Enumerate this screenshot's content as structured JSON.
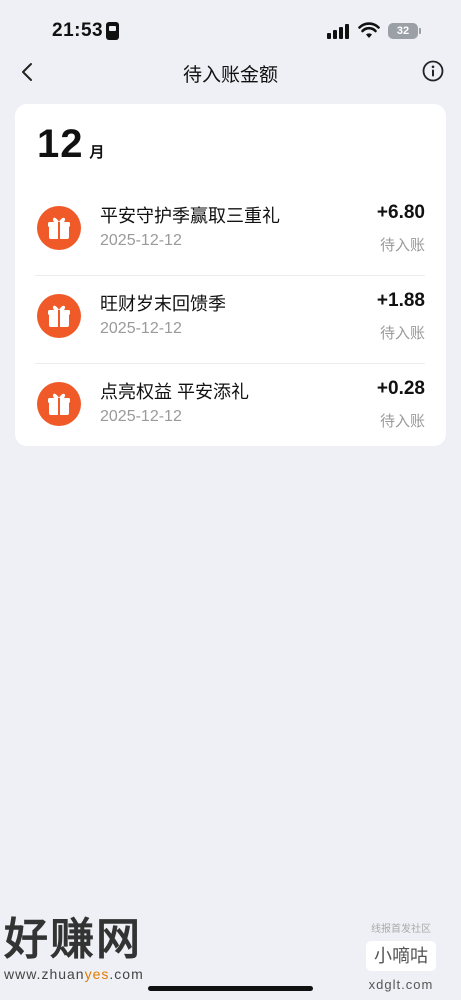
{
  "status_bar": {
    "time": "21:53",
    "battery": "32"
  },
  "header": {
    "title": "待入账金额"
  },
  "month": {
    "number": "12",
    "unit": "月"
  },
  "records": [
    {
      "name": "平安守护季赢取三重礼",
      "date": "2025-12-12",
      "amount": "+6.80",
      "status": "待入账"
    },
    {
      "name": "旺财岁末回馈季",
      "date": "2025-12-12",
      "amount": "+1.88",
      "status": "待入账"
    },
    {
      "name": "点亮权益 平安添礼",
      "date": "2025-12-12",
      "amount": "+0.28",
      "status": "待入账"
    }
  ],
  "watermark": {
    "left_big": "好赚网",
    "left_small_pre": "www.zhuan",
    "left_small_accent": "yes",
    "left_small_post": ".com",
    "right_tag": "线报首发社区",
    "right_box": "小嘀咕",
    "right_url": "xdglt.com"
  },
  "colors": {
    "accent_orange": "#f05a28",
    "background": "#eff0f5"
  }
}
